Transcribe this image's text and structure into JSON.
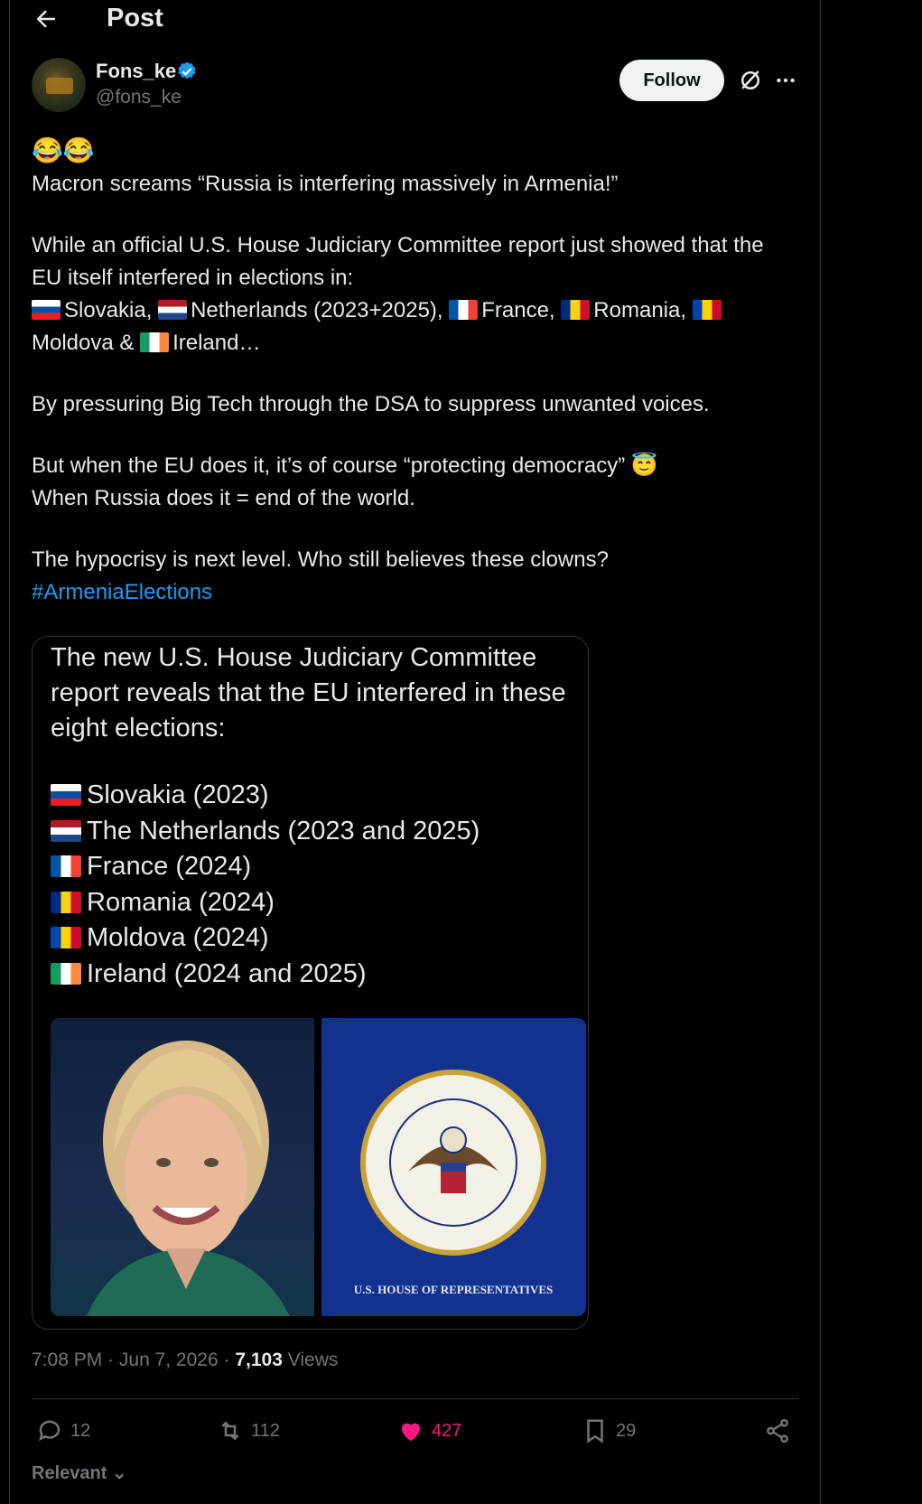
{
  "header": {
    "title": "Post"
  },
  "author": {
    "display_name": "Fons_ke",
    "handle": "@fons_ke"
  },
  "actions_top": {
    "follow_label": "Follow"
  },
  "post": {
    "emoji": "😂😂",
    "line1": "Macron screams “Russia is interfering massively in Armenia!”",
    "para2_a": "While an official U.S. House Judiciary Committee report just showed that the EU itself interfered in elections in:",
    "flags": [
      {
        "name": "Slovakia,",
        "colors": [
          "#ffffff",
          "#0b4ea2",
          "#ee1c25"
        ]
      },
      {
        "name": "Netherlands (2023+2025),",
        "colors": [
          "#ae1c28",
          "#ffffff",
          "#21468b"
        ]
      },
      {
        "name": "France,",
        "colors": [
          "#0055a4",
          "#ffffff",
          "#ef4135"
        ]
      },
      {
        "name": "Romania,",
        "colors": [
          "#002b7f",
          "#fcd116",
          "#ce1126"
        ]
      },
      {
        "name": "Moldova &",
        "colors": [
          "#0046ae",
          "#ffd200",
          "#cc092f"
        ]
      },
      {
        "name": "Ireland…",
        "colors": [
          "#169b62",
          "#ffffff",
          "#ff883e"
        ]
      }
    ],
    "para3": "By pressuring Big Tech through the DSA to suppress unwanted voices.",
    "para4_a": "But when the EU does it, it’s of course “protecting democracy” 😇",
    "para4_b": "When Russia does it = end of the world.",
    "para5": "The hypocrisy is next level. Who still believes these clowns?",
    "hashtag": "#ArmeniaElections"
  },
  "media": {
    "title": "The new U.S. House Judiciary Committee report reveals that the EU interfered in these eight elections:",
    "list": [
      {
        "text": "Slovakia (2023)",
        "colors": [
          "#ffffff",
          "#0b4ea2",
          "#ee1c25"
        ]
      },
      {
        "text": "The Netherlands (2023 and 2025)",
        "colors": [
          "#ae1c28",
          "#ffffff",
          "#21468b"
        ]
      },
      {
        "text": "France (2024)",
        "colors": [
          "#0055a4",
          "#ffffff",
          "#ef4135"
        ]
      },
      {
        "text": "Romania (2024)",
        "colors": [
          "#002b7f",
          "#fcd116",
          "#ce1126"
        ]
      },
      {
        "text": "Moldova (2024)",
        "colors": [
          "#0046ae",
          "#ffd200",
          "#cc092f"
        ]
      },
      {
        "text": "Ireland (2024 and 2025)",
        "colors": [
          "#169b62",
          "#ffffff",
          "#ff883e"
        ]
      }
    ],
    "seal_text": "U.S. HOUSE OF REPRESENTATIVES"
  },
  "meta": {
    "time": "7:08 PM",
    "sep1": " · ",
    "date": "Jun 7, 2026",
    "sep2": " · ",
    "views_count": "7,103",
    "views_label": " Views"
  },
  "stats": {
    "replies": "12",
    "reposts": "112",
    "likes": "427",
    "bookmarks": "29"
  },
  "colors": {
    "accent": "#1d9bf0",
    "like": "#f91880",
    "text": "#e7e9ea",
    "muted": "#71767b"
  },
  "sort": {
    "label": "Relevant"
  }
}
